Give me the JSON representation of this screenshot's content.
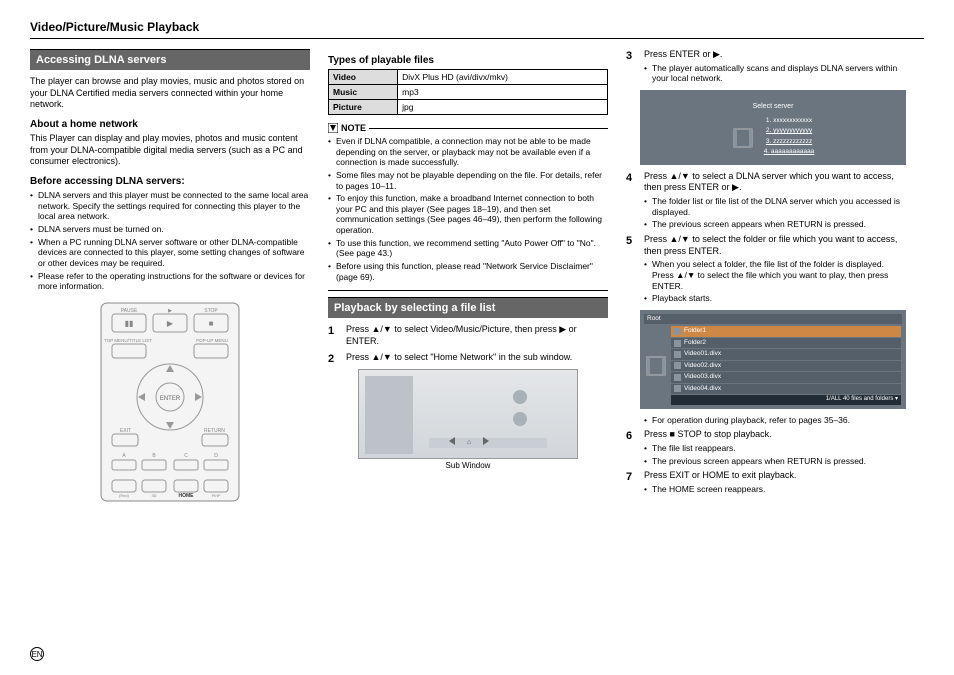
{
  "page_title": "Video/Picture/Music Playback",
  "col1": {
    "section_title": "Accessing DLNA servers",
    "intro": "The player can browse and play movies, music and photos stored on your DLNA Certified media servers connected within your home network.",
    "about_head": "About a home network",
    "about_text": "This Player can display and play movies, photos and music content from your DLNA-compatible digital media servers (such as a PC and consumer electronics).",
    "before_head": "Before accessing DLNA servers:",
    "before_bullets": [
      "DLNA servers and this player must be connected to the same local area network. Specify the settings required for connecting this player to the local area network.",
      "DLNA servers must be turned on.",
      "When a PC running DLNA server software or other DLNA-compatible devices are connected to this player, some setting changes of software or other devices may be required.",
      "Please refer to the operating instructions for the software or devices for more information."
    ]
  },
  "col2": {
    "types_head": "Types of playable files",
    "types_rows": [
      {
        "k": "Video",
        "v": "DivX Plus HD (avi/divx/mkv)"
      },
      {
        "k": "Music",
        "v": "mp3"
      },
      {
        "k": "Picture",
        "v": "jpg"
      }
    ],
    "note_label": "NOTE",
    "note_bullets": [
      "Even if DLNA compatible, a connection may not be able to be made depending on the server, or playback may not be available even if a connection is made successfully.",
      "Some files may not be playable depending on the file. For details, refer to pages 10–11.",
      "To enjoy this function, make a broadband Internet connection to both your PC and this player (See pages 18–19), and then set communication settings (See pages 46–49), then perform the following operation.",
      "To use this function, we recommend setting \"Auto Power Off\" to \"No\". (See page 43.)",
      "Before using this function, please read \"Network Service Disclaimer\" (page 69)."
    ],
    "playback_title": "Playback by selecting a file list",
    "step1": "Press ▲/▼ to select Video/Music/Picture, then press ▶ or ENTER.",
    "step2": "Press ▲/▼ to select \"Home Network\" in the sub window.",
    "subwin_caption": "Sub Window"
  },
  "col3": {
    "step3": "Press ENTER or ▶.",
    "step3_sub": "The player automatically scans and displays DLNA servers within your local network.",
    "select_server_title": "Select server",
    "server_items": [
      "1. xxxxxxxxxxxx",
      "2. yyyyyyyyyyyy",
      "3. zzzzzzzzzzzz",
      "4. aaaaaaaaaaaa"
    ],
    "step4": "Press ▲/▼ to select a DLNA server which you want to access, then press ENTER or ▶.",
    "step4_subs": [
      "The folder list or file list of the DLNA server which you accessed is displayed.",
      "The previous screen appears when  RETURN is pressed."
    ],
    "step5": "Press ▲/▼ to select the folder or file which you want to access, then press ENTER.",
    "step5_subs": [
      "When you select a folder, the file list of the folder is displayed. Press ▲/▼ to select the file which you want to play, then press ENTER.",
      "Playback starts."
    ],
    "root_title": "Root",
    "files": [
      "Folder1",
      "Folder2",
      "Video01.divx",
      "Video02.divx",
      "Video03.divx",
      "Video04.divx"
    ],
    "file_footer": "1/ALL  40 files and folders ▾",
    "after_root": "For operation during playback, refer to pages 35–36.",
    "step6": "Press ■ STOP to stop playback.",
    "step6_subs": [
      "The file list reappears.",
      "The previous screen appears when  RETURN is pressed."
    ],
    "step7": "Press EXIT or HOME to exit playback.",
    "step7_sub": "The HOME screen reappears."
  },
  "footer_lang": "EN"
}
